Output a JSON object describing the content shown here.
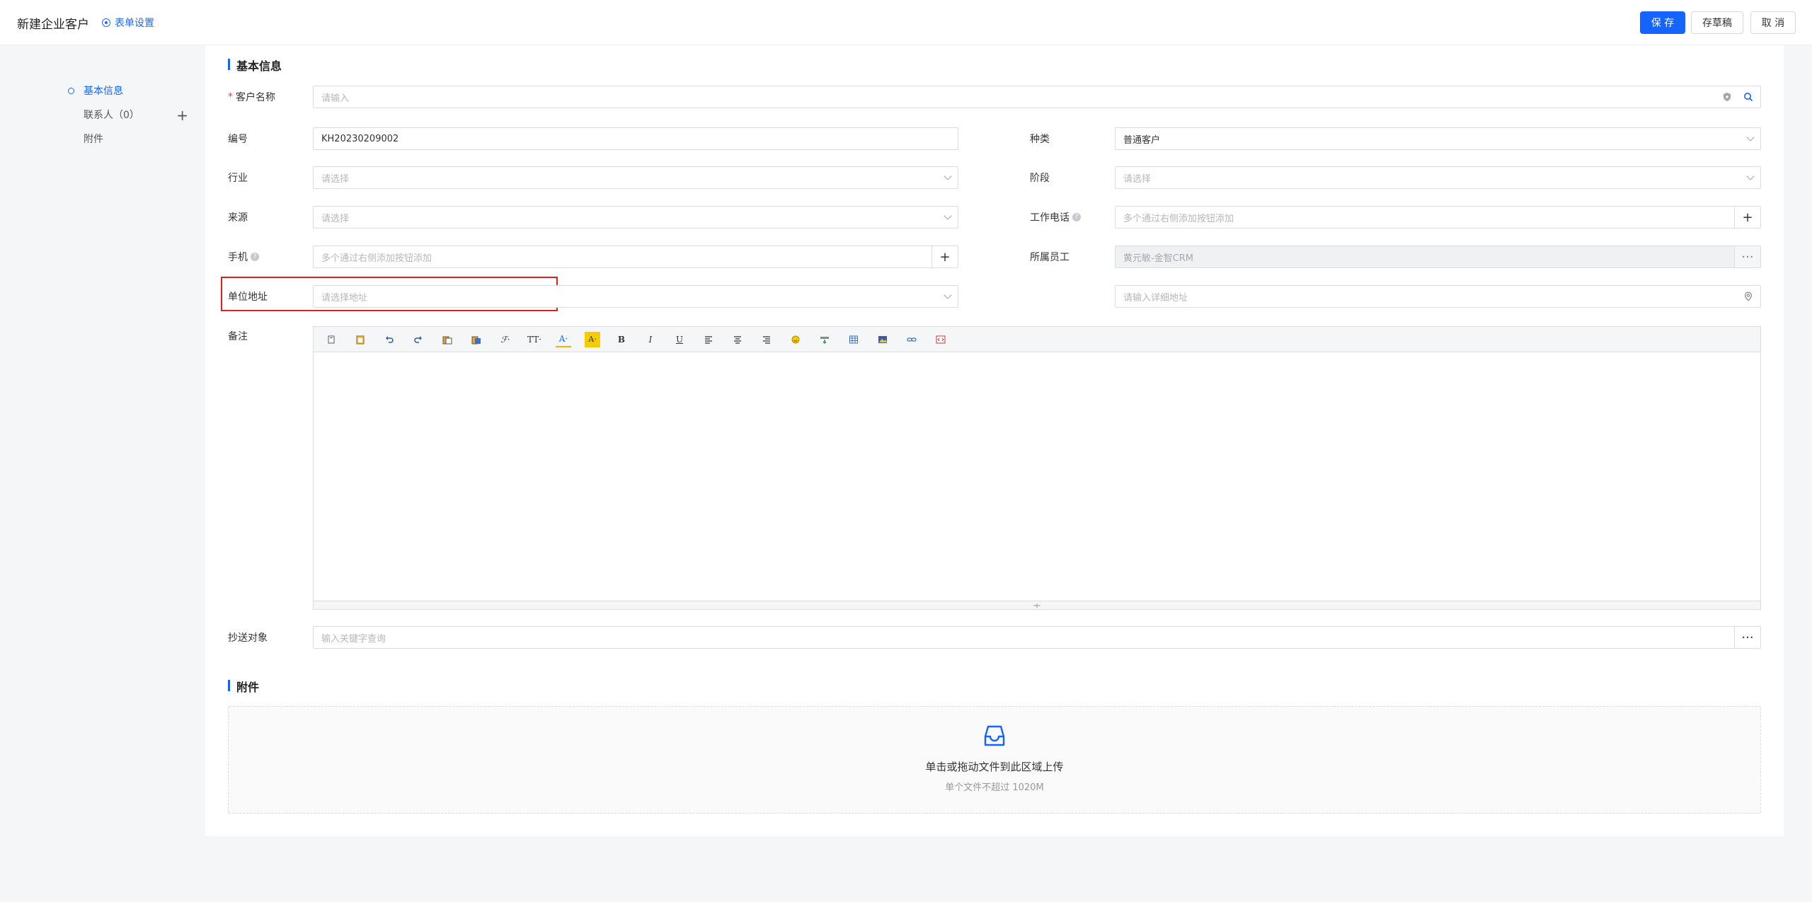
{
  "header": {
    "title": "新建企业客户",
    "form_settings": "表单设置",
    "save": "保 存",
    "draft": "存草稿",
    "cancel": "取 消"
  },
  "side_nav": {
    "items": [
      {
        "label": "基本信息",
        "active": true
      },
      {
        "label": "联系人（0）"
      },
      {
        "label": "附件"
      }
    ],
    "add_icon": "plus-icon"
  },
  "basic_info": {
    "title": "基本信息",
    "customer_name": {
      "label": "客户名称",
      "required": true,
      "placeholder": "请输入"
    },
    "code": {
      "label": "编号",
      "value": "KH20230209002"
    },
    "category": {
      "label": "种类",
      "value": "普通客户"
    },
    "industry": {
      "label": "行业",
      "placeholder": "请选择"
    },
    "stage": {
      "label": "阶段",
      "placeholder": "请选择"
    },
    "source": {
      "label": "来源",
      "placeholder": "请选择"
    },
    "work_phone": {
      "label": "工作电话",
      "placeholder": "多个通过右侧添加按钮添加"
    },
    "mobile": {
      "label": "手机",
      "placeholder": "多个通过右侧添加按钮添加"
    },
    "owner": {
      "label": "所属员工",
      "value": "黄元敏-金智CRM"
    },
    "address": {
      "label": "单位地址",
      "placeholder": "请选择地址"
    },
    "address_detail": {
      "placeholder": "请输入详细地址"
    },
    "remark": {
      "label": "备注"
    },
    "cc": {
      "label": "抄送对象",
      "placeholder": "输入关键字查询"
    }
  },
  "attachments": {
    "title": "附件",
    "upload_text": "单击或拖动文件到此区域上传",
    "upload_hint": "单个文件不超过 1020M"
  },
  "toolbar_icons": [
    "copy-icon",
    "paste-icon",
    "undo-icon",
    "redo-icon",
    "paste-text-icon",
    "paste-word-icon",
    "font-family-icon",
    "font-size-icon",
    "font-color-icon",
    "highlight-icon",
    "bold-icon",
    "italic-icon",
    "underline-icon",
    "align-left-icon",
    "align-center-icon",
    "align-right-icon",
    "emoji-icon",
    "insert-row-icon",
    "table-icon",
    "image-icon",
    "link-icon",
    "code-icon"
  ],
  "colors": {
    "primary": "#1664ff",
    "required": "#f53f3f",
    "highlight": "#e02020"
  }
}
